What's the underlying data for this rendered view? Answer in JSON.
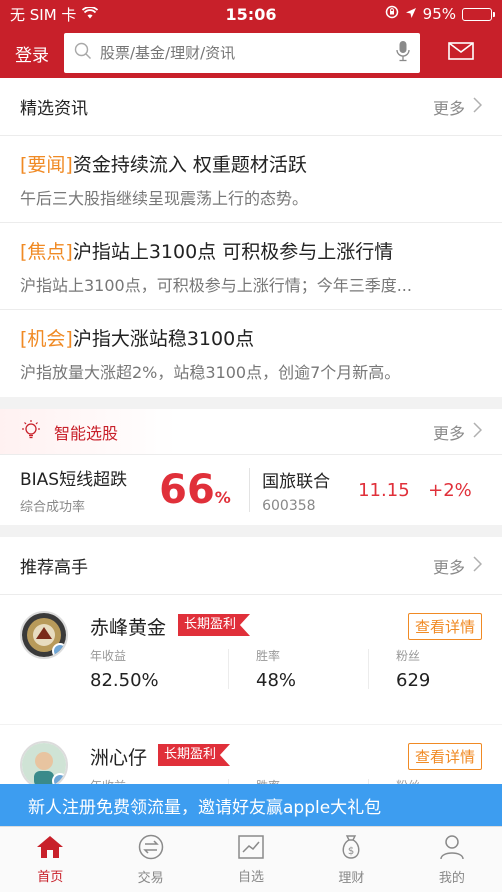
{
  "status_bar": {
    "carrier": "无 SIM 卡",
    "time": "15:06",
    "battery": "95%",
    "battery_level": 0.95
  },
  "header": {
    "login_label": "登录",
    "search_placeholder": "股票/基金/理财/资讯",
    "icons": [
      "search-icon",
      "mic-icon",
      "mail-icon"
    ]
  },
  "news": {
    "title": "精选资讯",
    "more": "更多",
    "items": [
      {
        "tag": "[要闻]",
        "title": "资金持续流入 权重题材活跃",
        "summary": "午后三大股指继续呈现震荡上行的态势。"
      },
      {
        "tag": "[焦点]",
        "title": "沪指站上3100点 可积极参与上涨行情",
        "summary": "沪指站上3100点，可积极参与上涨行情；今年三季度..."
      },
      {
        "tag": "[机会]",
        "title": "沪指大涨站稳3100点",
        "summary": "沪指放量大涨超2%，站稳3100点，创逾7个月新高。"
      }
    ]
  },
  "smart_pick": {
    "title": "智能选股",
    "more": "更多",
    "strategy_name": "BIAS短线超跌",
    "strategy_sub": "综合成功率",
    "success_rate": "66",
    "success_unit": "%",
    "stock_name": "国旅联合",
    "stock_code": "600358",
    "stock_price": "11.15",
    "stock_change": "+2%"
  },
  "experts": {
    "title": "推荐高手",
    "more": "更多",
    "tag_label": "长期盈利",
    "detail_label": "查看详情",
    "stat_labels": {
      "return": "年收益",
      "win": "胜率",
      "fans": "粉丝"
    },
    "items": [
      {
        "name": "赤峰黄金",
        "return": "82.50%",
        "win": "48%",
        "fans": "629"
      },
      {
        "name": "洲心仔",
        "return": "",
        "win": "",
        "fans": ""
      }
    ]
  },
  "promo": {
    "text": "新人注册免费领流量，邀请好友赢apple大礼包"
  },
  "tabs": [
    {
      "label": "首页",
      "icon": "home-icon",
      "active": true
    },
    {
      "label": "交易",
      "icon": "trade-icon",
      "active": false
    },
    {
      "label": "自选",
      "icon": "watchlist-icon",
      "active": false
    },
    {
      "label": "理财",
      "icon": "wealth-icon",
      "active": false
    },
    {
      "label": "我的",
      "icon": "profile-icon",
      "active": false
    }
  ],
  "colors": {
    "brand_red": "#c8202a",
    "accent_orange": "#f08a24",
    "rise_red": "#e0303a",
    "promo_blue": "#3d9df0"
  }
}
